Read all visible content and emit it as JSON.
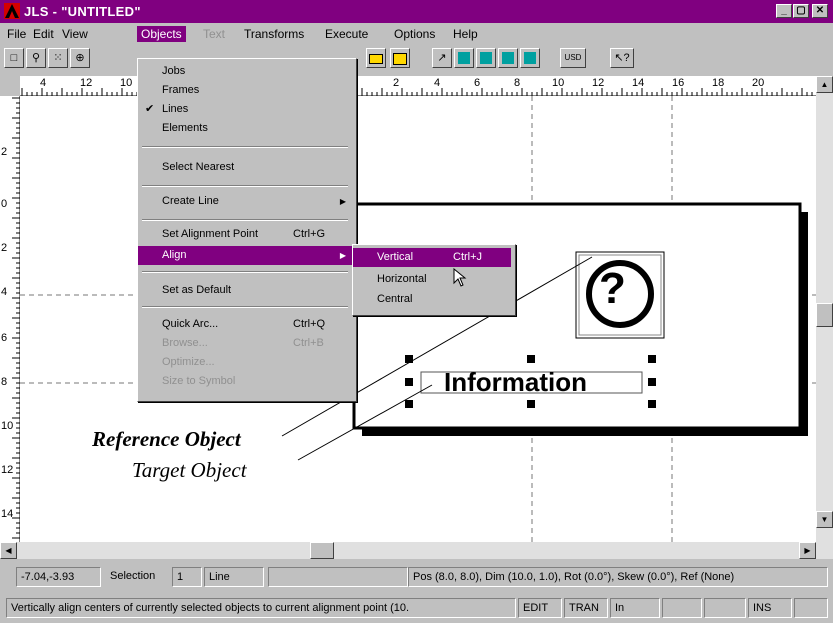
{
  "window": {
    "title": "JLS - \"UNTITLED\""
  },
  "menubar": [
    "File",
    "Edit",
    "View",
    "Objects",
    "Text",
    "Transforms",
    "Execute",
    "Options",
    "Help"
  ],
  "toolbar": {
    "label_usd": "USD"
  },
  "rulers": {
    "h_labels": [
      "4",
      "12",
      "10",
      "2",
      "4",
      "6",
      "8",
      "10",
      "12",
      "14",
      "16",
      "18",
      "20"
    ],
    "v_labels": [
      "2",
      "0",
      "2",
      "4",
      "6",
      "8",
      "10",
      "12",
      "14"
    ]
  },
  "objects_menu": {
    "items": [
      {
        "label": "Jobs"
      },
      {
        "label": "Frames"
      },
      {
        "label": "Lines",
        "checked": true
      },
      {
        "label": "Elements"
      },
      {
        "label": "Select Nearest"
      },
      {
        "label": "Create Line",
        "submenu": true
      },
      {
        "label": "Set Alignment Point",
        "shortcut": "Ctrl+G"
      },
      {
        "label": "Align",
        "submenu": true,
        "highlighted": true
      },
      {
        "label": "Set as Default"
      },
      {
        "label": "Quick Arc...",
        "shortcut": "Ctrl+Q"
      },
      {
        "label": "Browse...",
        "shortcut": "Ctrl+B",
        "disabled": true
      },
      {
        "label": "Optimize...",
        "disabled": true
      },
      {
        "label": "Size to Symbol",
        "disabled": true
      }
    ]
  },
  "align_menu": {
    "items": [
      {
        "label": "Vertical",
        "shortcut": "Ctrl+J",
        "highlighted": true
      },
      {
        "label": "Horizontal"
      },
      {
        "label": "Central"
      }
    ]
  },
  "canvas": {
    "symbol_text": "?",
    "info_text": "Information",
    "callout_reference": "Reference Object",
    "callout_target": "Target Object"
  },
  "status": {
    "coords": "-7.04,-3.93",
    "selection_label": "Selection",
    "selection_count": "1",
    "selection_type": "Line",
    "geometry": "Pos (8.0, 8.0), Dim (10.0, 1.0), Rot (0.0°), Skew (0.0°), Ref (None)",
    "hint": "Vertically align centers of currently selected objects to current alignment point (10.",
    "mode_edit": "EDIT",
    "mode_tran": "TRAN",
    "unit": "In",
    "insert": "INS"
  },
  "colors": {
    "titlebar": "#800080",
    "highlight": "#800080",
    "face": "#c0c0c0"
  },
  "icons": [
    "app-logo-icon",
    "minimize-icon",
    "maximize-icon",
    "close-icon",
    "select-rect-icon",
    "zoom-icon",
    "grid-icon",
    "help-pointer-icon",
    "question-symbol-icon",
    "mouse-pointer-icon"
  ]
}
